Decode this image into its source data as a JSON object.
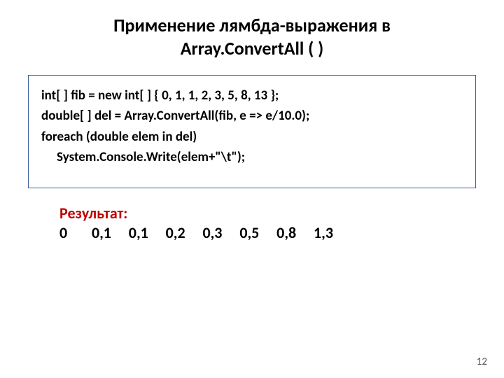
{
  "title_line1": "Применение лямбда-выражения в",
  "title_line2": "Array.ConvertAll ( )",
  "code": {
    "line1": "int[ ] fib = new int[ ] { 0, 1, 1, 2, 3, 5, 8, 13 };",
    "line2": "double[ ] del = Array.ConvertAll(fib, e => e/10.0);",
    "line3": "foreach (double elem in del)",
    "line4": "System.Console.Write(elem+\"\\t\");"
  },
  "result": {
    "label": "Результат:",
    "values": "0       0,1     0,1     0,2     0,3     0,5     0,8     1,3"
  },
  "page_number": "12"
}
